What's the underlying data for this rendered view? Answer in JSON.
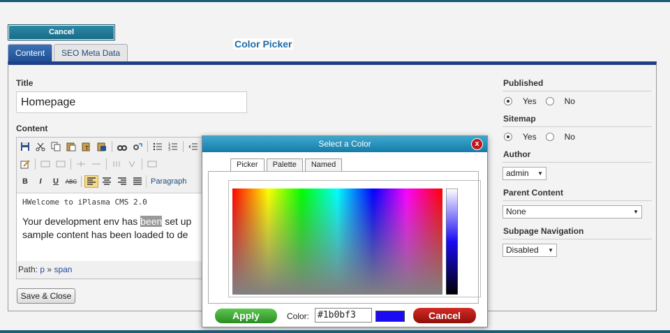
{
  "header": {
    "cancel_label": "Cancel"
  },
  "tabs": [
    {
      "label": "Content",
      "active": true
    },
    {
      "label": "SEO Meta Data",
      "active": false
    }
  ],
  "form": {
    "title_label": "Title",
    "title_value": "Homepage",
    "content_label": "Content",
    "format_select": "Paragraph",
    "editor_heading": "HWelcome to iPlasma CMS 2.0",
    "editor_line1_pre": "Your development env has ",
    "editor_line1_sel": "been",
    "editor_line1_post": " set up",
    "editor_line2": "sample content has been loaded to de",
    "path_label": "Path:",
    "path_p": "p",
    "path_sep": "»",
    "path_span": "span",
    "save_label": "Save & Close"
  },
  "sidebar": {
    "published_label": "Published",
    "published_yes": "Yes",
    "published_no": "No",
    "published_value": "Yes",
    "sitemap_label": "Sitemap",
    "sitemap_yes": "Yes",
    "sitemap_no": "No",
    "sitemap_value": "Yes",
    "author_label": "Author",
    "author_value": "admin",
    "parent_label": "Parent Content",
    "parent_value": "None",
    "subpage_label": "Subpage Navigation",
    "subpage_value": "Disabled"
  },
  "dialog": {
    "title": "Select a Color",
    "close_label": "x",
    "tabs": [
      "Picker",
      "Palette",
      "Named"
    ],
    "active_tab": "Picker",
    "legend": "Color Picker",
    "apply_label": "Apply",
    "color_label": "Color:",
    "color_value": "#1b0bf3",
    "cancel_label": "Cancel",
    "swatch_color": "#1b0bf3"
  },
  "icons": [
    "save-icon",
    "cut-icon",
    "copy-icon",
    "paste-icon",
    "paste-text-icon",
    "paste-word-icon",
    "find-icon",
    "replace-icon",
    "bullet-list-icon",
    "number-list-icon",
    "outdent-icon",
    "bold-icon",
    "italic-icon",
    "underline-icon",
    "strike-icon",
    "align-left-icon",
    "align-center-icon",
    "align-right-icon",
    "align-justify-icon"
  ]
}
